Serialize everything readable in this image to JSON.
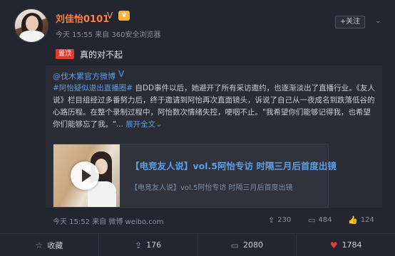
{
  "post": {
    "username": "刘佳怡0101",
    "meta": "今天 15:55 来自 360安全浏览器",
    "follow_label": "+关注",
    "pin_label": "置顶",
    "text": "真的对不起"
  },
  "repost": {
    "author": "@伐木累官方微博",
    "tag": "#阿怡疑似退出直播圈#",
    "body": " 自DD事件以后，她避开了所有采访邀约，也逐渐淡出了直播行业。《友人说》栏目组经过多番努力后，终于邀请到阿怡再次直面镜头，诉说了自己从一夜成名到跌落低谷的心路历程。在整个录制过程中，阿怡数次情绪失控，哽咽不止。\"我希望你们能够记得我，也希望你们能够忘了我。\"...",
    "more": "展开全文",
    "video": {
      "title": "【电竞友人说】vol.5阿怡专访 时隔三月后首度出镜",
      "subtitle": "【电竞友人说】vol.5阿怡专访 时隔三月后首度出镜"
    },
    "footer": {
      "time": "今天 15:52 来自 微博 weibo.com",
      "reposts": "230",
      "comments": "484",
      "likes": "124"
    }
  },
  "actions": {
    "collect": "收藏",
    "repost": "176",
    "comment": "2080",
    "like": "1784"
  }
}
